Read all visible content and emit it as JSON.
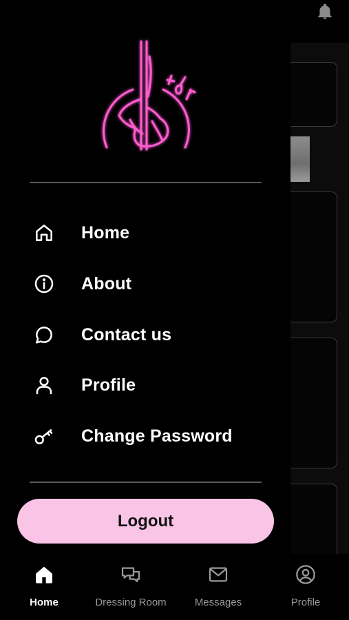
{
  "app": {
    "logo_text": "tdr",
    "notification_icon": "bell-icon"
  },
  "drawer": {
    "menu": [
      {
        "label": "Home",
        "icon": "home-icon"
      },
      {
        "label": "About",
        "icon": "info-icon"
      },
      {
        "label": "Contact us",
        "icon": "chat-bubble-icon"
      },
      {
        "label": "Profile",
        "icon": "person-icon"
      },
      {
        "label": "Change Password",
        "icon": "key-icon"
      }
    ],
    "logout_label": "Logout"
  },
  "bottom_nav": {
    "items": [
      {
        "label": "Home",
        "icon": "home-filled-icon",
        "active": true
      },
      {
        "label": "Dressing Room",
        "icon": "dual-chat-icon",
        "active": false
      },
      {
        "label": "Messages",
        "icon": "envelope-icon",
        "active": false
      },
      {
        "label": "Profile",
        "icon": "user-circle-icon",
        "active": false
      }
    ]
  },
  "colors": {
    "background": "#000000",
    "logout_button": "#fac4e6",
    "logo_neon": "#ff5bd0",
    "active_nav_text": "#ffffff",
    "inactive_nav_text": "#9a9a9a"
  }
}
